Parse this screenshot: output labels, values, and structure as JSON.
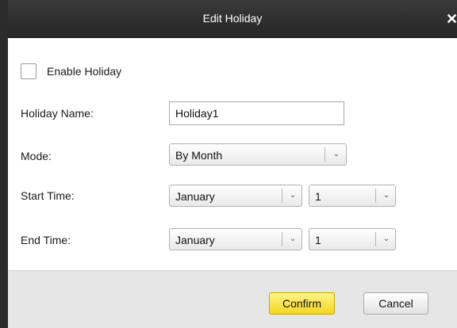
{
  "window": {
    "title": "Edit Holiday",
    "close_glyph": "✕"
  },
  "form": {
    "enable_holiday": {
      "label": "Enable Holiday",
      "checked": false
    },
    "holiday_name": {
      "label": "Holiday Name:",
      "value": "Holiday1"
    },
    "mode": {
      "label": "Mode:",
      "value": "By Month"
    },
    "start_time": {
      "label": "Start Time:",
      "month": "January",
      "day": "1"
    },
    "end_time": {
      "label": "End Time:",
      "month": "January",
      "day": "1"
    }
  },
  "buttons": {
    "confirm": "Confirm",
    "cancel": "Cancel"
  },
  "icons": {
    "dropdown_arrow": "chevron-down-icon",
    "close": "close-icon"
  },
  "colors": {
    "titlebar": "#2b2b2b",
    "confirm_button": "#f3d71e",
    "footer": "#e6e6e6"
  }
}
